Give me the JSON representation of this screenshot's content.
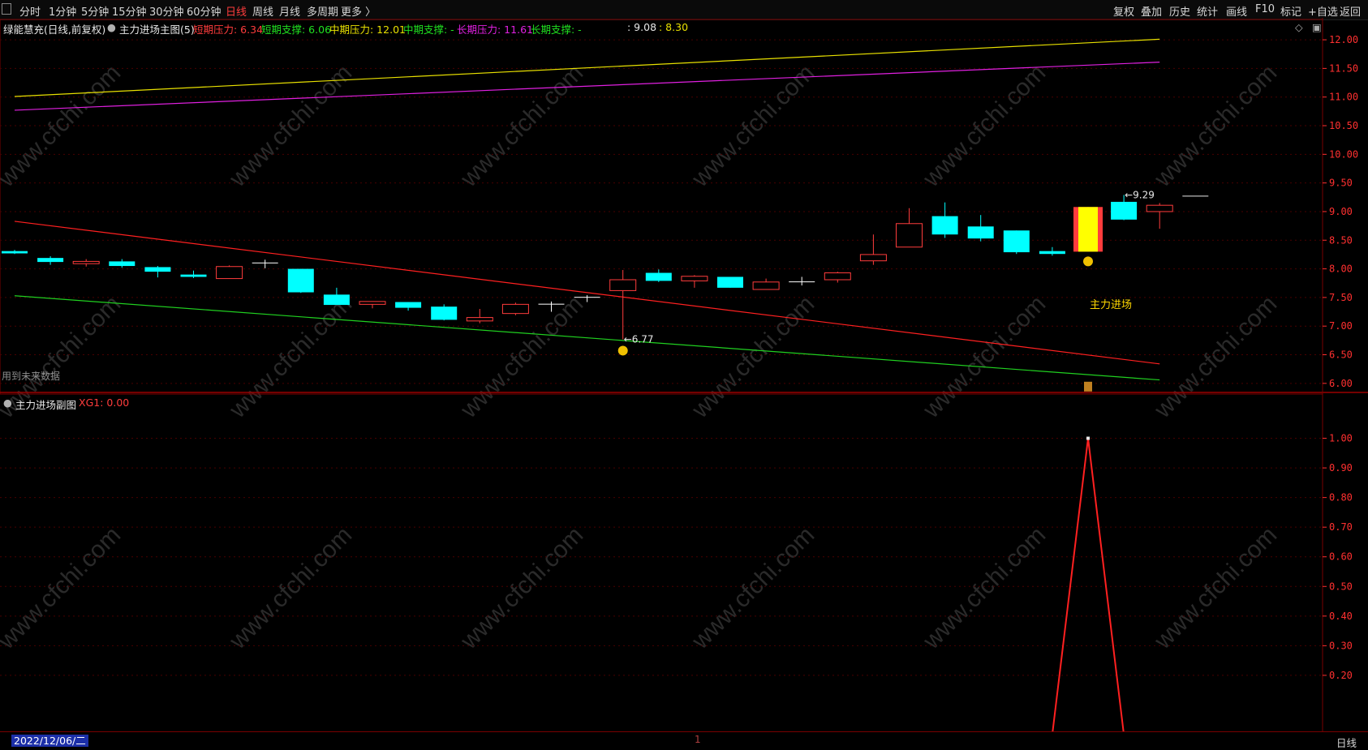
{
  "toolbar": {
    "left_items": [
      {
        "label": "分时",
        "active": false
      },
      {
        "label": "1分钟",
        "active": false
      },
      {
        "label": "5分钟",
        "active": false
      },
      {
        "label": "15分钟",
        "active": false
      },
      {
        "label": "30分钟",
        "active": false
      },
      {
        "label": "60分钟",
        "active": false
      },
      {
        "label": "日线",
        "active": true
      },
      {
        "label": "周线",
        "active": false
      },
      {
        "label": "月线",
        "active": false
      },
      {
        "label": "多周期",
        "active": false
      },
      {
        "label": "更多 〉",
        "active": false
      }
    ],
    "right_items": [
      "复权",
      "叠加",
      "历史",
      "统计",
      "画线",
      "F10",
      "标记",
      "+自选",
      "返回"
    ]
  },
  "main_info": {
    "stock": "绿能慧充(日线,前复权)",
    "indicator": "主力进场主图(5)",
    "short_pressure": "短期压力: 6.34",
    "short_support": "短期支撑: 6.06",
    "mid_pressure": "中期压力: 12.01",
    "mid_support": "中期支撑: -",
    "long_pressure": "长期压力: 11.61",
    "long_support": "长期支撑: -",
    "extra": ": 9.08",
    "extra2": ": 8.30",
    "future_note": "用到未来数据"
  },
  "sub_info": {
    "indicator": "主力进场副图",
    "xg1": "XG1: 0.00"
  },
  "bottom": {
    "date": "2022/12/06/二",
    "period": "日线",
    "scroll_mark": "1"
  },
  "chart_data": {
    "type": "candlestick",
    "main_axis": {
      "ylim": [
        5.87,
        12.27
      ],
      "ticks": [
        "12.00",
        "11.50",
        "11.00",
        "10.50",
        "10.00",
        "9.50",
        "9.00",
        "8.50",
        "8.00",
        "7.50",
        "7.00",
        "6.50",
        "6.00"
      ]
    },
    "candles": [
      {
        "o": 8.31,
        "h": 8.33,
        "l": 8.26,
        "c": 8.27
      },
      {
        "o": 8.19,
        "h": 8.22,
        "l": 8.07,
        "c": 8.12
      },
      {
        "o": 8.09,
        "h": 8.17,
        "l": 8.04,
        "c": 8.13
      },
      {
        "o": 8.13,
        "h": 8.17,
        "l": 8.02,
        "c": 8.05
      },
      {
        "o": 8.03,
        "h": 8.05,
        "l": 7.85,
        "c": 7.95
      },
      {
        "o": 7.9,
        "h": 7.97,
        "l": 7.84,
        "c": 7.86
      },
      {
        "o": 7.83,
        "h": 8.06,
        "l": 7.83,
        "c": 8.04
      },
      {
        "o": 8.11,
        "h": 8.16,
        "l": 8.01,
        "c": 8.1
      },
      {
        "o": 8.0,
        "h": 8.0,
        "l": 7.58,
        "c": 7.59
      },
      {
        "o": 7.55,
        "h": 7.67,
        "l": 7.37,
        "c": 7.37
      },
      {
        "o": 7.38,
        "h": 7.43,
        "l": 7.31,
        "c": 7.43
      },
      {
        "o": 7.42,
        "h": 7.42,
        "l": 7.27,
        "c": 7.32
      },
      {
        "o": 7.34,
        "h": 7.38,
        "l": 7.1,
        "c": 7.11
      },
      {
        "o": 7.09,
        "h": 7.3,
        "l": 7.05,
        "c": 7.15
      },
      {
        "o": 7.22,
        "h": 7.41,
        "l": 7.19,
        "c": 7.38
      },
      {
        "o": 7.39,
        "h": 7.43,
        "l": 7.25,
        "c": 7.38
      },
      {
        "o": 7.51,
        "h": 7.54,
        "l": 7.42,
        "c": 7.5
      },
      {
        "o": 7.62,
        "h": 7.98,
        "l": 6.77,
        "c": 7.81
      },
      {
        "o": 7.93,
        "h": 7.99,
        "l": 7.77,
        "c": 7.79
      },
      {
        "o": 7.79,
        "h": 7.89,
        "l": 7.67,
        "c": 7.87
      },
      {
        "o": 7.86,
        "h": 7.86,
        "l": 7.67,
        "c": 7.67
      },
      {
        "o": 7.64,
        "h": 7.83,
        "l": 7.64,
        "c": 7.77
      },
      {
        "o": 7.78,
        "h": 7.86,
        "l": 7.71,
        "c": 7.78
      },
      {
        "o": 7.81,
        "h": 7.95,
        "l": 7.76,
        "c": 7.93
      },
      {
        "o": 8.14,
        "h": 8.6,
        "l": 8.07,
        "c": 8.25
      },
      {
        "o": 8.38,
        "h": 9.06,
        "l": 8.38,
        "c": 8.79
      },
      {
        "o": 8.92,
        "h": 9.16,
        "l": 8.54,
        "c": 8.6
      },
      {
        "o": 8.74,
        "h": 8.94,
        "l": 8.48,
        "c": 8.53
      },
      {
        "o": 8.67,
        "h": 8.67,
        "l": 8.26,
        "c": 8.29
      },
      {
        "o": 8.31,
        "h": 8.38,
        "l": 8.23,
        "c": 8.26
      },
      {
        "o": 8.3,
        "h": 9.08,
        "l": 8.3,
        "c": 9.08
      },
      {
        "o": 9.17,
        "h": 9.29,
        "l": 8.85,
        "c": 8.86
      },
      {
        "o": 9.0,
        "h": 9.15,
        "l": 8.7,
        "c": 9.11
      }
    ],
    "last_price_marker": 9.27,
    "annotations": [
      {
        "text": "←6.77",
        "price": 6.77,
        "candle": 17
      },
      {
        "text": "←9.29",
        "price": 9.29,
        "candle": 31
      },
      {
        "text": "主力进场",
        "candle": 30
      }
    ],
    "trend_lines": [
      {
        "name": "中期压力",
        "color": "#e8e000",
        "start": 11.01,
        "end": 12.01
      },
      {
        "name": "长期压力",
        "color": "#e020e0",
        "start": 10.77,
        "end": 11.61
      },
      {
        "name": "短期压力",
        "color": "#ff2020",
        "start": 8.83,
        "end": 6.34
      },
      {
        "name": "短期支撑",
        "color": "#20d020",
        "start": 7.53,
        "end": 6.06
      }
    ],
    "sub_axis": {
      "ylim": [
        0,
        1.1
      ],
      "ticks": [
        "1.00",
        "0.90",
        "0.80",
        "0.70",
        "0.60",
        "0.50",
        "0.40",
        "0.30",
        "0.20"
      ]
    },
    "xg1": [
      0,
      0,
      0,
      0,
      0,
      0,
      0,
      0,
      0,
      0,
      0,
      0,
      0,
      0,
      0,
      0,
      0,
      0,
      0,
      0,
      0,
      0,
      0,
      0,
      0,
      0,
      0,
      0,
      0,
      0,
      1,
      0,
      0,
      0
    ],
    "colors": {
      "up": "#ff3c3c",
      "down": "#00ffff",
      "signal": "#ffff00",
      "grid": "#5a0000",
      "axis": "#ff3030"
    }
  }
}
